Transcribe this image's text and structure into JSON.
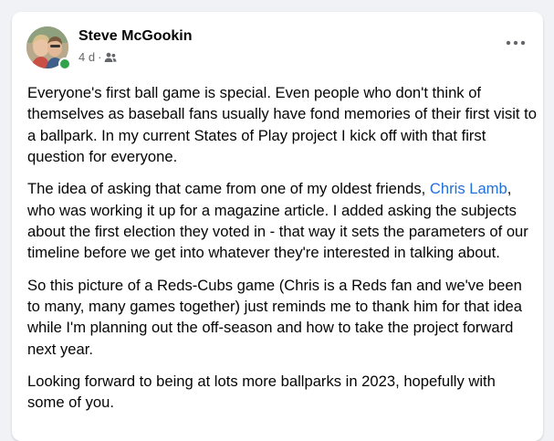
{
  "post": {
    "author": "Steve McGookin",
    "timestamp": "4 d",
    "separator": "·",
    "audience_icon": "friends-icon",
    "more_icon": "more-options-icon",
    "presence_color": "#31a24c",
    "link_color": "#216fdb",
    "paragraphs": [
      {
        "text": "Everyone's first ball game is special. Even people who don't think of themselves as baseball fans usually have fond memories of their first visit to a ballpark. In my current States of Play project I kick off with that first question for everyone."
      },
      {
        "before": "The idea of asking that came from one of my oldest friends, ",
        "link": "Chris Lamb",
        "after": ", who was working it up for a magazine article. I added asking the subjects about the first election they voted in - that way it sets the parameters of our timeline before we get into whatever they're interested in talking about."
      },
      {
        "text": "So this picture of a Reds-Cubs game (Chris is a Reds fan and we've been to many, many games together) just reminds me to thank him for that idea while I'm planning out the off-season and how to take the project forward next year."
      },
      {
        "text": "Looking forward to being at lots more ballparks in 2023, hopefully with some of you."
      }
    ]
  }
}
